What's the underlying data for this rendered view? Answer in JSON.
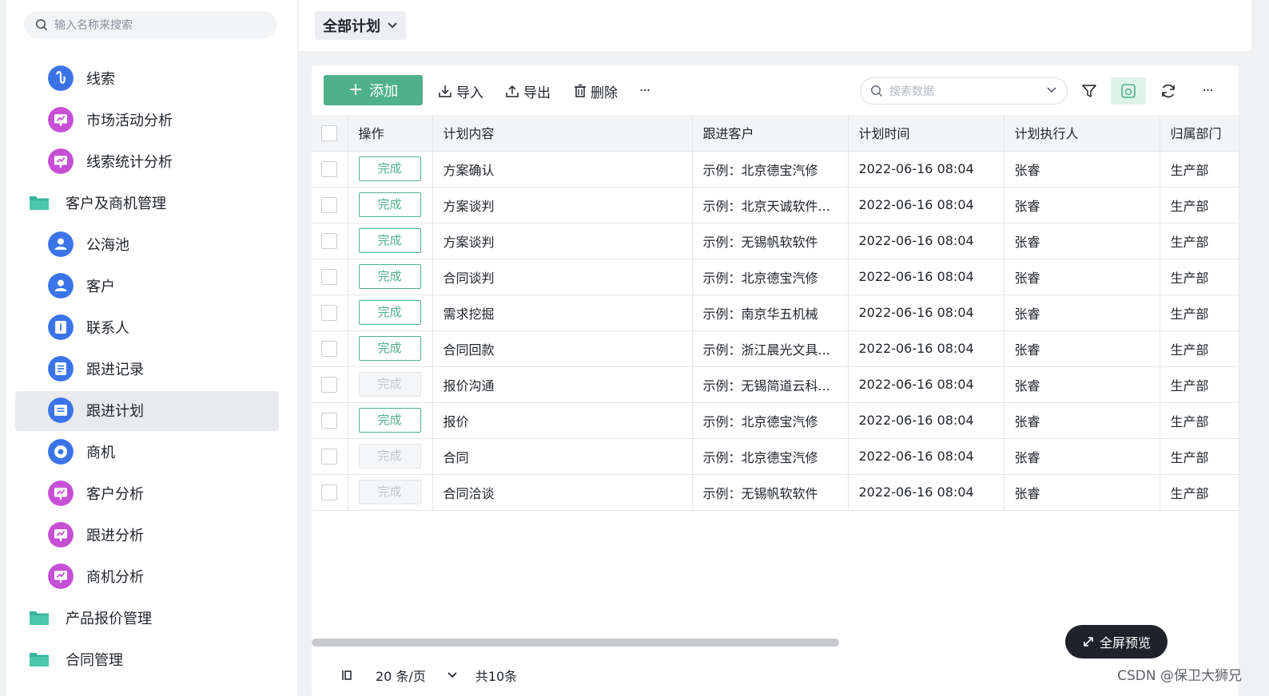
{
  "sidebar": {
    "search_placeholder": "输入名称来搜索",
    "items": [
      {
        "label": "线索",
        "kind": "child",
        "icon": "clue-icon",
        "color": "blue"
      },
      {
        "label": "市场活动分析",
        "kind": "child",
        "icon": "chart-icon",
        "color": "purple"
      },
      {
        "label": "线索统计分析",
        "kind": "child",
        "icon": "chart-icon",
        "color": "purple"
      },
      {
        "label": "客户及商机管理",
        "kind": "group",
        "icon": "folder-icon"
      },
      {
        "label": "公海池",
        "kind": "child",
        "icon": "user-icon",
        "color": "blue"
      },
      {
        "label": "客户",
        "kind": "child",
        "icon": "user-icon",
        "color": "blue"
      },
      {
        "label": "联系人",
        "kind": "child",
        "icon": "contact-icon",
        "color": "blue"
      },
      {
        "label": "跟进记录",
        "kind": "child",
        "icon": "record-icon",
        "color": "blue"
      },
      {
        "label": "跟进计划",
        "kind": "child",
        "icon": "plan-icon",
        "color": "blue",
        "active": true
      },
      {
        "label": "商机",
        "kind": "child",
        "icon": "opportunity-icon",
        "color": "blue"
      },
      {
        "label": "客户分析",
        "kind": "child",
        "icon": "chart-icon",
        "color": "purple"
      },
      {
        "label": "跟进分析",
        "kind": "child",
        "icon": "chart-icon",
        "color": "purple"
      },
      {
        "label": "商机分析",
        "kind": "child",
        "icon": "chart-icon",
        "color": "purple"
      },
      {
        "label": "产品报价管理",
        "kind": "group",
        "icon": "folder-icon"
      },
      {
        "label": "合同管理",
        "kind": "group",
        "icon": "folder-icon"
      }
    ]
  },
  "header": {
    "view_label": "全部计划"
  },
  "toolbar": {
    "add_label": "添加",
    "import_label": "导入",
    "export_label": "导出",
    "delete_label": "删除",
    "more_label": "···",
    "search_placeholder": "搜索数据"
  },
  "table": {
    "columns": [
      "操作",
      "计划内容",
      "跟进客户",
      "计划时间",
      "计划执行人",
      "归属部门"
    ],
    "action_label": "完成",
    "rows": [
      {
        "done_enabled": true,
        "content": "方案确认",
        "customer": "示例：北京德宝汽修",
        "time": "2022-06-16 08:04",
        "executor": "张睿",
        "dept": "生产部"
      },
      {
        "done_enabled": true,
        "content": "方案谈判",
        "customer": "示例：北京天诚软件...",
        "time": "2022-06-16 08:04",
        "executor": "张睿",
        "dept": "生产部"
      },
      {
        "done_enabled": true,
        "content": "方案谈判",
        "customer": "示例：无锡帆软软件",
        "time": "2022-06-16 08:04",
        "executor": "张睿",
        "dept": "生产部"
      },
      {
        "done_enabled": true,
        "content": "合同谈判",
        "customer": "示例：北京德宝汽修",
        "time": "2022-06-16 08:04",
        "executor": "张睿",
        "dept": "生产部"
      },
      {
        "done_enabled": true,
        "content": "需求挖掘",
        "customer": "示例：南京华五机械",
        "time": "2022-06-16 08:04",
        "executor": "张睿",
        "dept": "生产部"
      },
      {
        "done_enabled": true,
        "content": "合同回款",
        "customer": "示例：浙江晨光文具...",
        "time": "2022-06-16 08:04",
        "executor": "张睿",
        "dept": "生产部"
      },
      {
        "done_enabled": false,
        "content": "报价沟通",
        "customer": "示例：无锡简道云科...",
        "time": "2022-06-16 08:04",
        "executor": "张睿",
        "dept": "生产部"
      },
      {
        "done_enabled": true,
        "content": "报价",
        "customer": "示例：北京德宝汽修",
        "time": "2022-06-16 08:04",
        "executor": "张睿",
        "dept": "生产部"
      },
      {
        "done_enabled": false,
        "content": "合同",
        "customer": "示例：北京德宝汽修",
        "time": "2022-06-16 08:04",
        "executor": "张睿",
        "dept": "生产部"
      },
      {
        "done_enabled": false,
        "content": "合同洽谈",
        "customer": "示例：无锡帆软软件",
        "time": "2022-06-16 08:04",
        "executor": "张睿",
        "dept": "生产部"
      }
    ]
  },
  "pagination": {
    "page_size": "20 条/页",
    "total": "共10条"
  },
  "fullscreen_label": "全屏预览",
  "watermark": "CSDN @保卫大狮兄",
  "colors": {
    "accent": "#4fb18b",
    "blue_icon": "#3b74e8",
    "purple_icon": "#c64fd6",
    "folder": "#36b49a"
  }
}
